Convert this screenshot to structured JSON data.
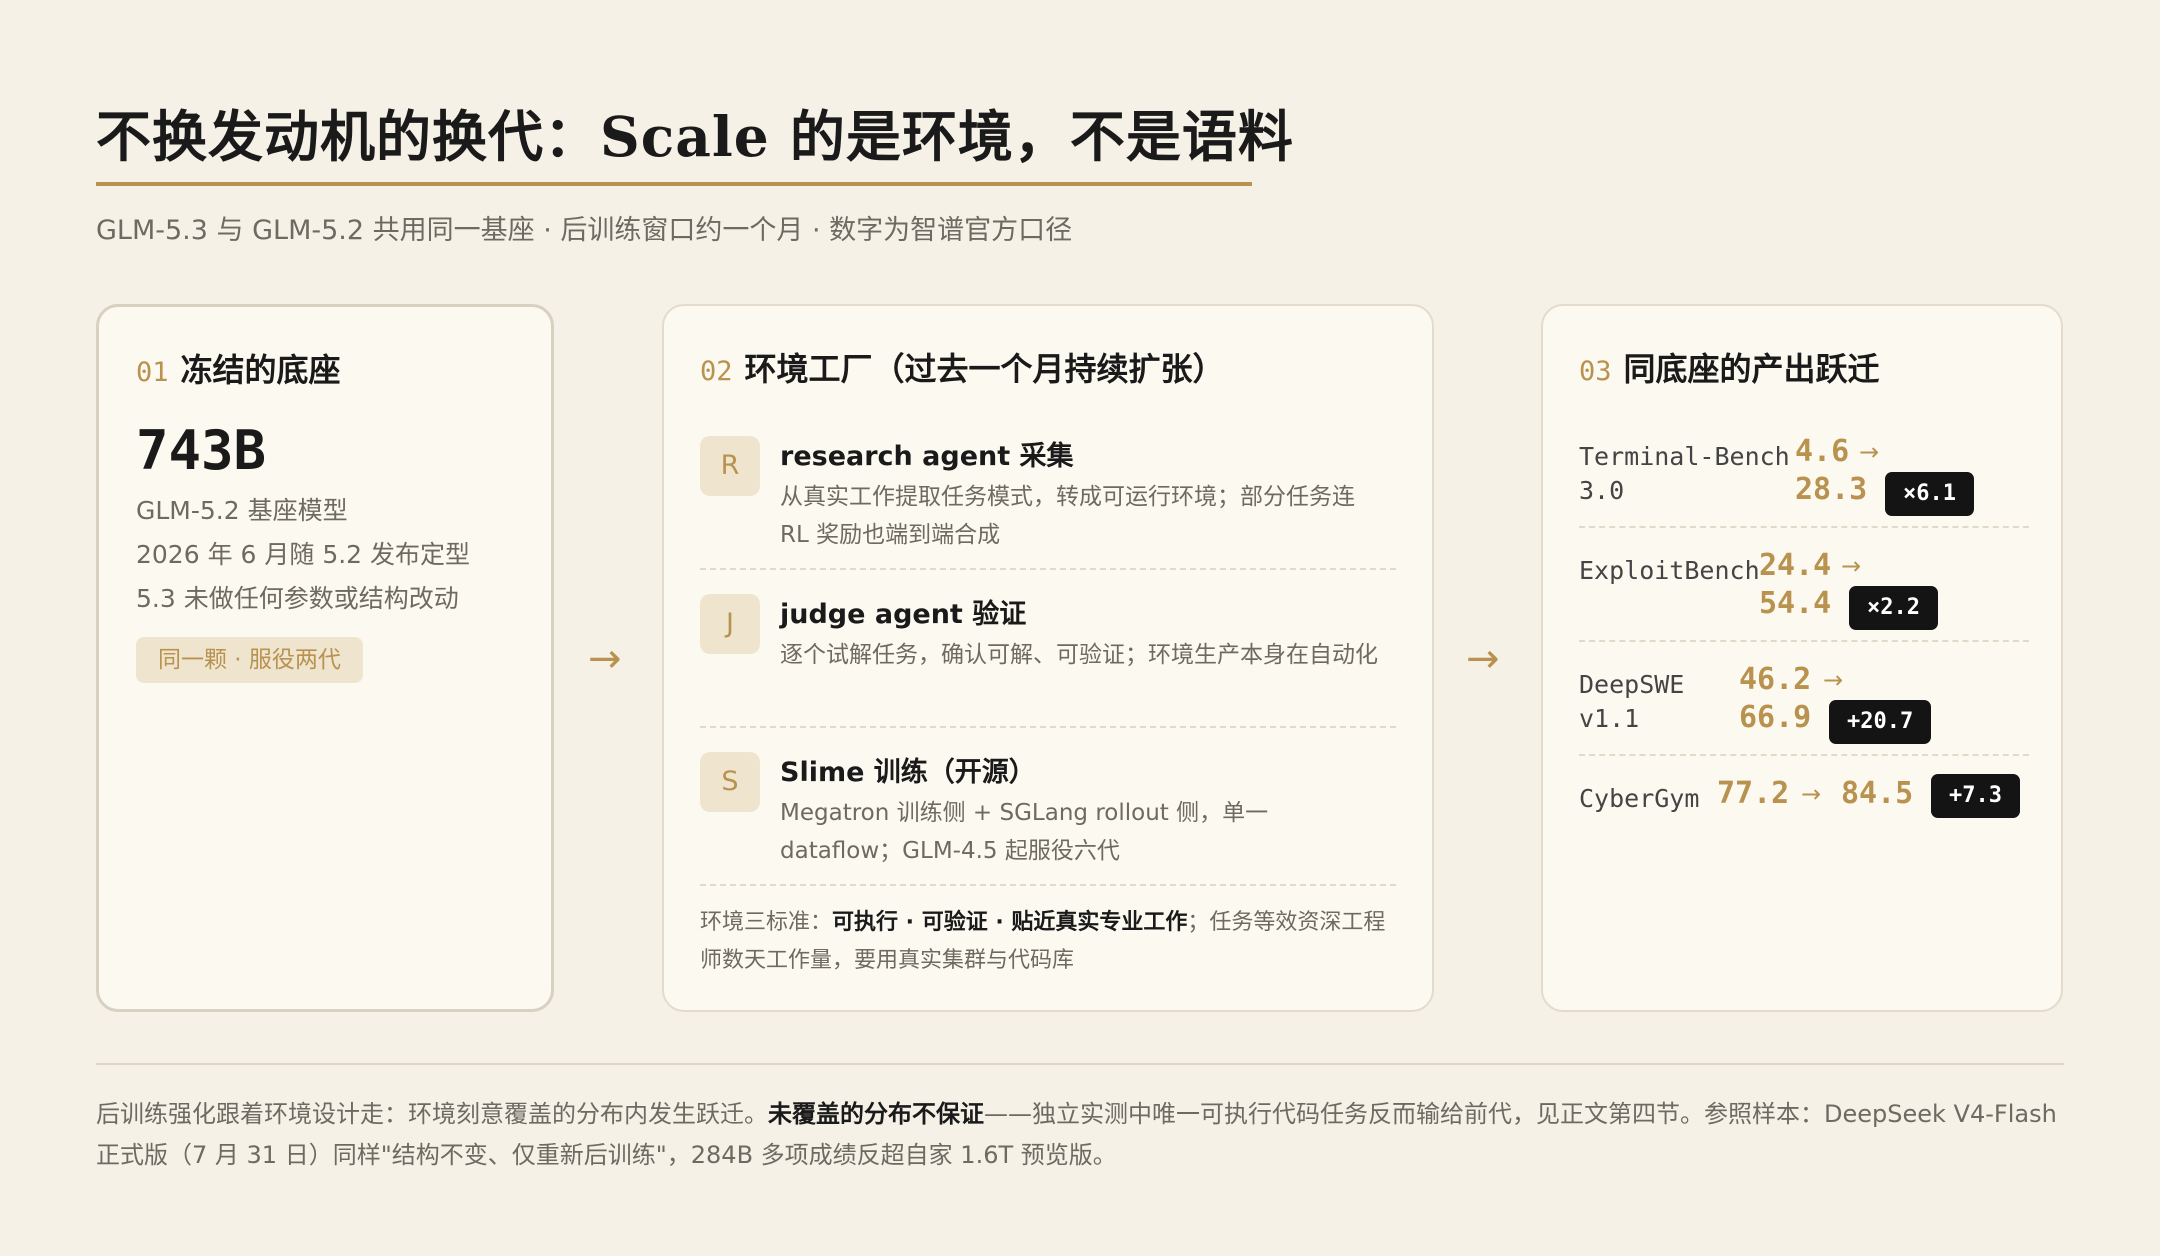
{
  "title": "不换发动机的换代：Scale 的是环境，不是语料",
  "subtitle": "GLM-5.3 与 GLM-5.2 共用同一基座 · 后训练窗口约一个月 · 数字为智谱官方口径",
  "accent_color": "#b8924e",
  "arrow_glyph": "→",
  "card1": {
    "num": "01",
    "heading": "冻结的底座",
    "big_number": "743B",
    "lines": [
      "GLM-5.2 基座模型",
      "2026 年 6 月随 5.2 发布定型",
      "5.3 未做任何参数或结构改动"
    ],
    "pill": "同一颗 · 服役两代"
  },
  "card2": {
    "num": "02",
    "heading": "环境工厂（过去一个月持续扩张）",
    "steps": [
      {
        "badge": "R",
        "title": "research agent 采集",
        "desc": "从真实工作提取任务模式，转成可运行环境；部分任务连 RL 奖励也端到端合成"
      },
      {
        "badge": "J",
        "title": "judge agent 验证",
        "desc": "逐个试解任务，确认可解、可验证；环境生产本身在自动化"
      },
      {
        "badge": "S",
        "title": "Slime 训练（开源）",
        "desc": "Megatron 训练侧 + SGLang rollout 侧，单一 dataflow；GLM-4.5 起服役六代"
      }
    ],
    "standards_prefix": "环境三标准：",
    "standards_bold": "可执行 · 可验证 · 贴近真实专业工作",
    "standards_suffix": "；任务等效资深工程师数天工作量，要用真实集群与代码库"
  },
  "card3": {
    "num": "03",
    "heading": "同底座的产出跃迁",
    "metrics": [
      {
        "name_line1": "Terminal-Bench",
        "name_line2": "3.0",
        "before": "4.6",
        "after": "28.3",
        "delta": "×6.1"
      },
      {
        "name_line1": "ExploitBench",
        "name_line2": "",
        "before": "24.4",
        "after": "54.4",
        "delta": "×2.2"
      },
      {
        "name_line1": "DeepSWE",
        "name_line2": "v1.1",
        "before": "46.2",
        "after": "66.9",
        "delta": "+20.7"
      },
      {
        "name_line1": "CyberGym",
        "name_line2": "",
        "before": "77.2",
        "after": "84.5",
        "delta": "+7.3"
      }
    ]
  },
  "footer": {
    "part1": "后训练强化跟着环境设计走：环境刻意覆盖的分布内发生跃迁。",
    "bold": "未覆盖的分布不保证",
    "part2": "——独立实测中唯一可执行代码任务反而输给前代，见正文第四节。参照样本：DeepSeek V4-Flash 正式版（7 月 31 日）同样\"结构不变、仅重新后训练\"，284B 多项成绩反超自家 1.6T 预览版。"
  }
}
